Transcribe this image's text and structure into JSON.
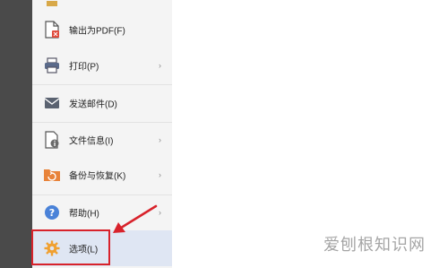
{
  "menu": {
    "items": [
      {
        "label": "输出为PDF(F)",
        "icon": "pdf-export-icon",
        "has_submenu": false
      },
      {
        "label": "打印(P)",
        "icon": "printer-icon",
        "has_submenu": true
      },
      {
        "label": "发送邮件(D)",
        "icon": "mail-icon",
        "has_submenu": false
      },
      {
        "label": "文件信息(I)",
        "icon": "file-info-icon",
        "has_submenu": true
      },
      {
        "label": "备份与恢复(K)",
        "icon": "backup-restore-icon",
        "has_submenu": true
      },
      {
        "label": "帮助(H)",
        "icon": "help-icon",
        "has_submenu": true
      },
      {
        "label": "选项(L)",
        "icon": "gear-icon",
        "has_submenu": false
      }
    ],
    "chevron": "›"
  },
  "watermark": "爱刨根知识网",
  "colors": {
    "highlight_red": "#d8222b",
    "selected_bg": "#dfe6f3",
    "gear_orange": "#f0a030",
    "help_blue": "#4a82d8"
  }
}
